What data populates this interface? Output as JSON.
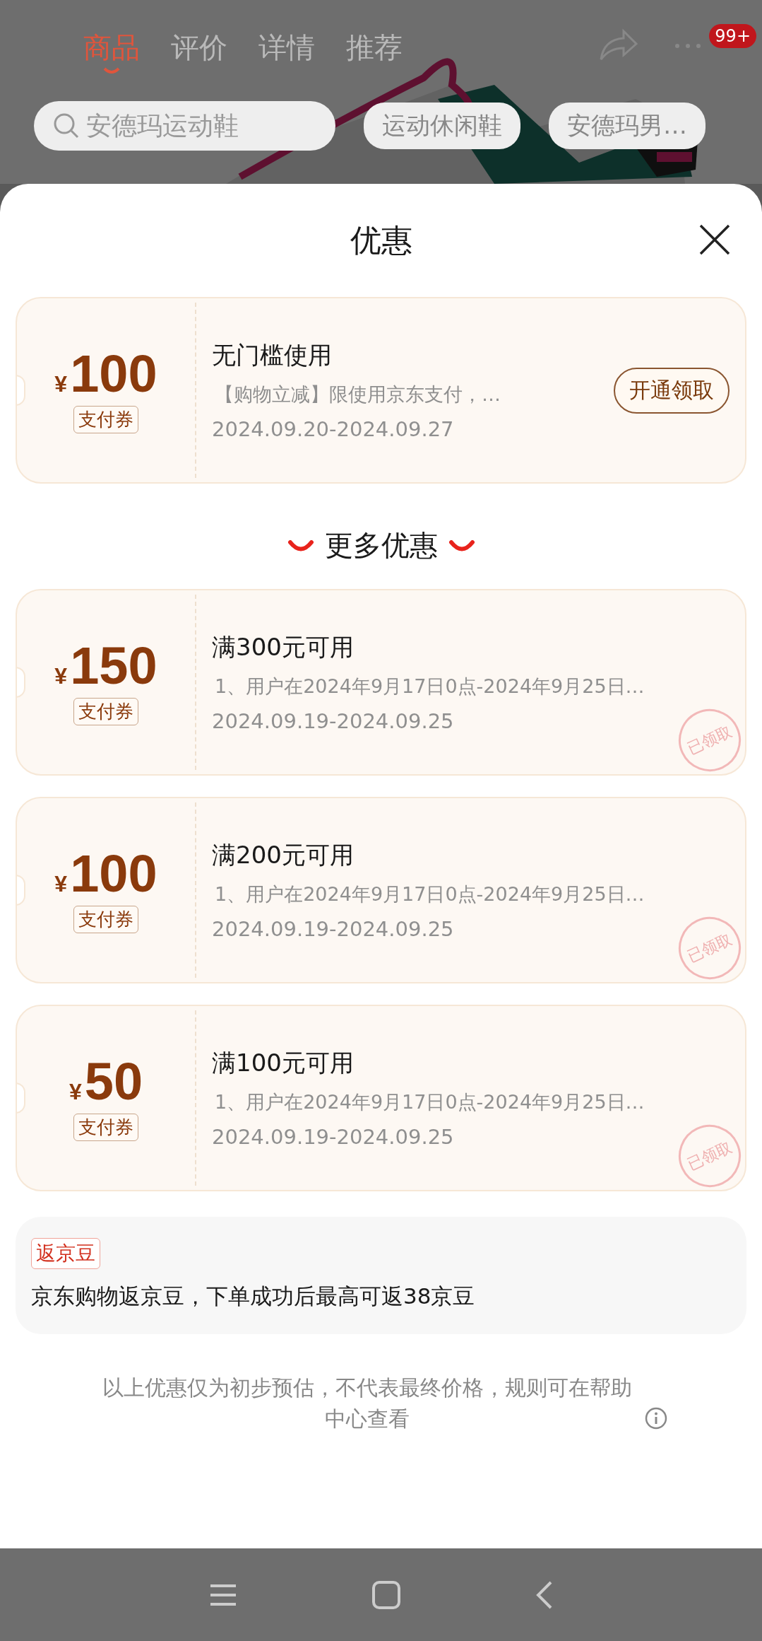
{
  "header": {
    "tabs": [
      {
        "label": "商品",
        "selected": true
      },
      {
        "label": "评价",
        "selected": false
      },
      {
        "label": "详情",
        "selected": false
      },
      {
        "label": "推荐",
        "selected": false
      }
    ],
    "badge": "99+",
    "search": {
      "value": "安德玛运动鞋"
    },
    "chips": [
      "运动休闲鞋",
      "安德玛男…"
    ]
  },
  "sheet": {
    "title": "优惠",
    "featured": [
      {
        "currency": "¥",
        "amount": "100",
        "tag": "支付券",
        "title": "无门槛使用",
        "desc": "【购物立减】限使用京东支付，…",
        "dates": "2024.09.20-2024.09.27",
        "kind": "action",
        "button": "开通领取"
      }
    ],
    "more_title": "更多优惠",
    "coupons": [
      {
        "currency": "¥",
        "amount": "150",
        "tag": "支付券",
        "title": "满300元可用",
        "desc": "1、用户在2024年9月17日0点-2024年9月25日…",
        "dates": "2024.09.19-2024.09.25",
        "kind": "claimed",
        "stamp": "已领取"
      },
      {
        "currency": "¥",
        "amount": "100",
        "tag": "支付券",
        "title": "满200元可用",
        "desc": "1、用户在2024年9月17日0点-2024年9月25日…",
        "dates": "2024.09.19-2024.09.25",
        "kind": "claimed",
        "stamp": "已领取"
      },
      {
        "currency": "¥",
        "amount": "50",
        "tag": "支付券",
        "title": "满100元可用",
        "desc": "1、用户在2024年9月17日0点-2024年9月25日…",
        "dates": "2024.09.19-2024.09.25",
        "kind": "claimed",
        "stamp": "已领取"
      }
    ],
    "beans": {
      "tag": "返京豆",
      "text": "京东购物返京豆，下单成功后最高可返38京豆"
    },
    "footnote": "以上优惠仅为初步预估，不代表最终价格，规则可在帮助中心查看"
  }
}
